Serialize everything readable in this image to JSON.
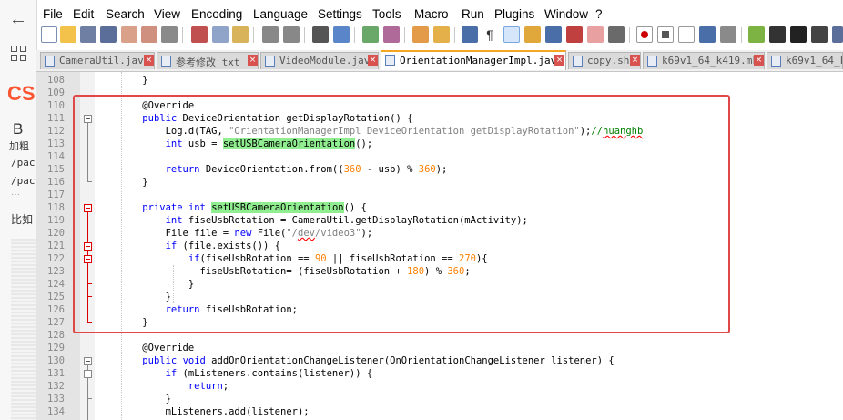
{
  "browser_sidebar": {
    "logo": "CS",
    "bold_letter": "B",
    "bold_label": "加粗",
    "line1": "/pac",
    "line2": "/pac",
    "dots": "···",
    "line3": "比如"
  },
  "menu": [
    "File",
    "Edit",
    "Search",
    "View",
    "Encoding",
    "Language",
    "Settings",
    "Tools",
    "Macro",
    "Run",
    "Plugins",
    "Window",
    "?"
  ],
  "tabs": [
    {
      "label": "CameraUtil.java",
      "active": false
    },
    {
      "label": "参考修改 txt",
      "active": false
    },
    {
      "label": "VideoModule.java",
      "active": false
    },
    {
      "label": "OrientationManagerImpl.java",
      "active": true
    },
    {
      "label": "copy.sh",
      "active": false
    },
    {
      "label": "k69v1_64_k419.mk",
      "active": false
    },
    {
      "label": "k69v1_64_k",
      "active": false
    }
  ],
  "line_numbers": [
    "108",
    "109",
    "110",
    "111",
    "112",
    "113",
    "114",
    "115",
    "116",
    "117",
    "118",
    "119",
    "120",
    "121",
    "122",
    "123",
    "124",
    "125",
    "126",
    "127",
    "128",
    "129",
    "130",
    "131",
    "132",
    "133",
    "134"
  ],
  "code_lines": [
    "    }",
    "",
    "    @Override",
    "    public DeviceOrientation getDisplayRotation() {",
    "        Log.d(TAG, \"OrientationManagerImpl DeviceOrientation getDisplayRotation\");//huanghb",
    "        int usb = setUSBCameraOrientation();",
    "",
    "        return DeviceOrientation.from((360 - usb) % 360);",
    "    }",
    "",
    "    private int setUSBCameraOrientation() {",
    "        int fiseUsbRotation = CameraUtil.getDisplayRotation(mActivity);",
    "        File file = new File(\"/dev/video3\");",
    "        if (file.exists()) {",
    "            if(fiseUsbRotation == 90 || fiseUsbRotation == 270){",
    "              fiseUsbRotation= (fiseUsbRotation + 180) % 360;",
    "            }",
    "        }",
    "        return fiseUsbRotation;",
    "    }",
    "",
    "    @Override",
    "    public void addOnOrientationChangeListener(OnOrientationChangeListener listener) {",
    "        if (mListeners.contains(listener)) {",
    "            return;",
    "        }",
    "        mListeners.add(listener);"
  ],
  "colors": {
    "keyword": "#0000ff",
    "string": "#808080",
    "number": "#ff8000",
    "comment": "#008000",
    "highlight": "#90ee90",
    "selection_box": "#e04848",
    "active_tab_accent": "#f5a623"
  }
}
